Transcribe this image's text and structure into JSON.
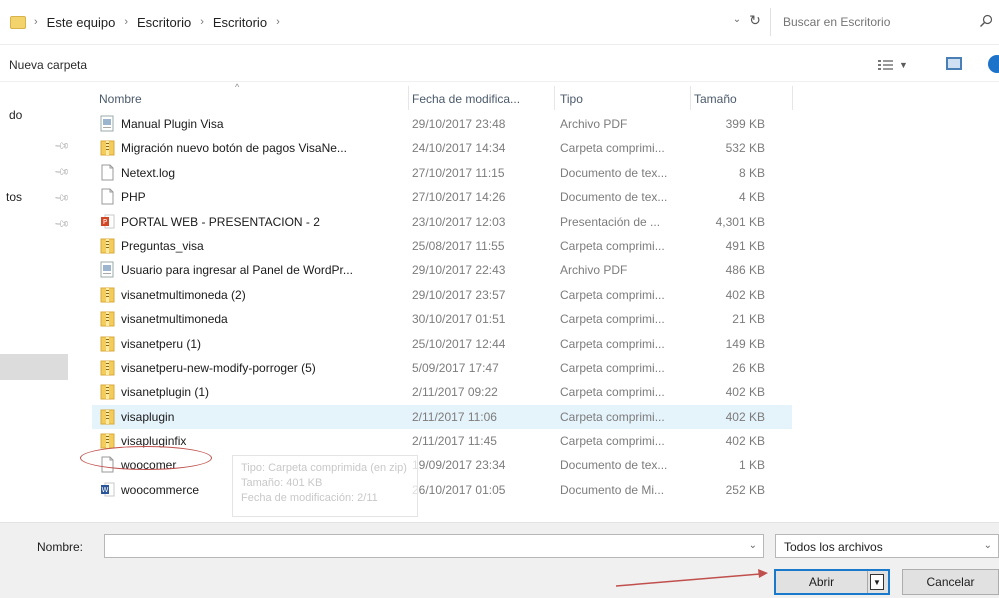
{
  "address_bar": {
    "breadcrumbs": [
      "Este equipo",
      "Escritorio",
      "Escritorio"
    ],
    "search_placeholder": "Buscar en Escritorio"
  },
  "toolbar": {
    "new_folder_label": "Nueva carpeta"
  },
  "nav": {
    "items": [
      {
        "label": "do"
      },
      {
        "label": "tos"
      }
    ]
  },
  "columns": {
    "name": "Nombre",
    "date": "Fecha de modifica...",
    "type": "Tipo",
    "size": "Tamaño"
  },
  "files": [
    {
      "name": "Manual Plugin Visa",
      "date": "29/10/2017 23:48",
      "type": "Archivo PDF",
      "size": "399 KB",
      "icon": "pdf"
    },
    {
      "name": "Migración nuevo botón de pagos VisaNe...",
      "date": "24/10/2017 14:34",
      "type": "Carpeta comprimi...",
      "size": "532 KB",
      "icon": "zip"
    },
    {
      "name": "Netext.log",
      "date": "27/10/2017 11:15",
      "type": "Documento de tex...",
      "size": "8 KB",
      "icon": "doc"
    },
    {
      "name": "PHP",
      "date": "27/10/2017 14:26",
      "type": "Documento de tex...",
      "size": "4 KB",
      "icon": "doc"
    },
    {
      "name": "PORTAL WEB - PRESENTACION - 2",
      "date": "23/10/2017 12:03",
      "type": "Presentación de ...",
      "size": "4,301 KB",
      "icon": "ppt"
    },
    {
      "name": "Preguntas_visa",
      "date": "25/08/2017 11:55",
      "type": "Carpeta comprimi...",
      "size": "491 KB",
      "icon": "zip"
    },
    {
      "name": "Usuario para ingresar al Panel de WordPr...",
      "date": "29/10/2017 22:43",
      "type": "Archivo PDF",
      "size": "486 KB",
      "icon": "pdf"
    },
    {
      "name": "visanetmultimoneda (2)",
      "date": "29/10/2017 23:57",
      "type": "Carpeta comprimi...",
      "size": "402 KB",
      "icon": "zip"
    },
    {
      "name": "visanetmultimoneda",
      "date": "30/10/2017 01:51",
      "type": "Carpeta comprimi...",
      "size": "21 KB",
      "icon": "zip"
    },
    {
      "name": "visanetperu (1)",
      "date": "25/10/2017 12:44",
      "type": "Carpeta comprimi...",
      "size": "149 KB",
      "icon": "zip"
    },
    {
      "name": "visanetperu-new-modify-porroger (5)",
      "date": "5/09/2017 17:47",
      "type": "Carpeta comprimi...",
      "size": "26 KB",
      "icon": "zip"
    },
    {
      "name": "visanetplugin (1)",
      "date": "2/11/2017 09:22",
      "type": "Carpeta comprimi...",
      "size": "402 KB",
      "icon": "zip"
    },
    {
      "name": "visaplugin",
      "date": "2/11/2017 11:06",
      "type": "Carpeta comprimi...",
      "size": "402 KB",
      "icon": "zip",
      "hover": true
    },
    {
      "name": "visapluginfix",
      "date": "2/11/2017 11:45",
      "type": "Carpeta comprimi...",
      "size": "402 KB",
      "icon": "zip"
    },
    {
      "name": "woocomer",
      "date": "19/09/2017 23:34",
      "type": "Documento de tex...",
      "size": "1 KB",
      "icon": "doc"
    },
    {
      "name": "woocommerce",
      "date": "26/10/2017 01:05",
      "type": "Documento de Mi...",
      "size": "252 KB",
      "icon": "word"
    }
  ],
  "tooltip": {
    "line1": "Tipo: Carpeta comprimida (en zip)",
    "line2": "Tamaño: 401 KB",
    "line3": "Fecha de modificación: 2/11"
  },
  "bottom": {
    "filename_label": "Nombre:",
    "filename_value": "",
    "filter_label": "Todos los archivos",
    "open_label": "Abrir",
    "cancel_label": "Cancelar"
  },
  "colors": {
    "accent": "#1979ca",
    "annotation": "#c0504d",
    "hover": "#e5f3fb"
  }
}
